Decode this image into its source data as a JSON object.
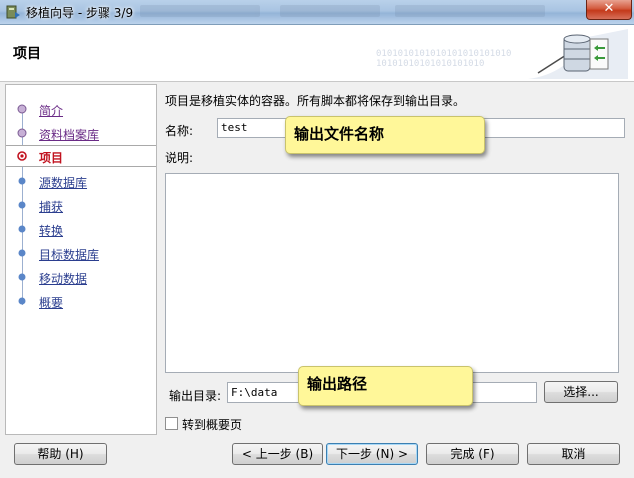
{
  "window": {
    "title": "移植向导 - 步骤 3/9",
    "close_label": "✕"
  },
  "header": {
    "title": "项目",
    "binary_text": "0101010101010101010101010 10101010101010101010"
  },
  "nav": {
    "items": [
      {
        "label": "简介",
        "state": "done"
      },
      {
        "label": "资料档案库",
        "state": "done"
      },
      {
        "label": "项目",
        "state": "current"
      },
      {
        "label": "源数据库",
        "state": "future"
      },
      {
        "label": "捕获",
        "state": "future"
      },
      {
        "label": "转换",
        "state": "future"
      },
      {
        "label": "目标数据库",
        "state": "future"
      },
      {
        "label": "移动数据",
        "state": "future"
      },
      {
        "label": "概要",
        "state": "future"
      }
    ]
  },
  "main": {
    "intro": "项目是移植实体的容器。所有脚本都将保存到输出目录。",
    "name_label": "名称:",
    "name_value": "test",
    "description_label": "说明:",
    "description_value": "",
    "output_dir_label": "输出目录:",
    "output_dir_value": "F:\\data",
    "choose_button": "选择...",
    "checkbox_label": "转到概要页",
    "checkbox_checked": false
  },
  "buttons": {
    "help": "帮助 (H)",
    "back": "< 上一步 (B)",
    "next": "下一步 (N) >",
    "finish": "完成 (F)",
    "cancel": "取消"
  },
  "annotations": {
    "name_callout": "输出文件名称",
    "path_callout": "输出路径"
  },
  "colors": {
    "nav_done": "#6a2b86",
    "nav_current": "#c1121f",
    "nav_future": "#2b3e8f",
    "callout_bg": "#fff799"
  }
}
